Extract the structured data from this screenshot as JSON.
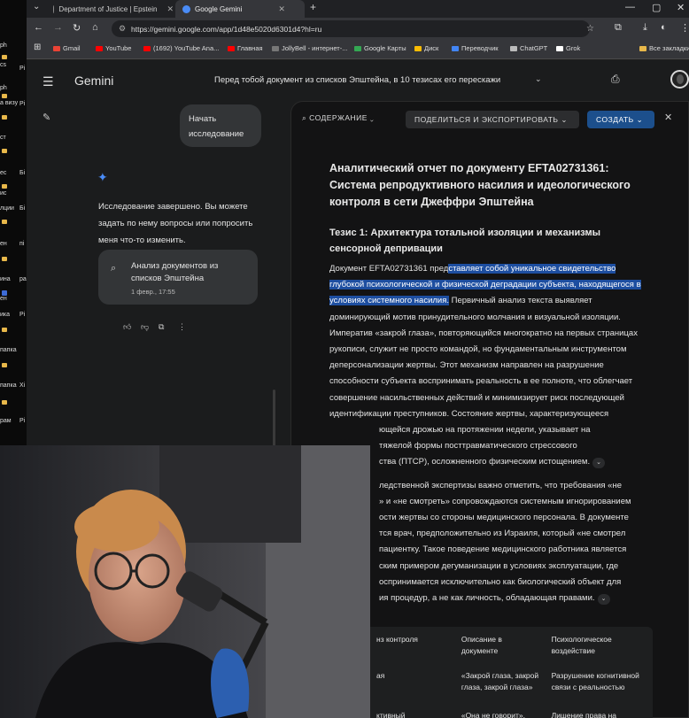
{
  "desktop": {
    "labels": [
      "ph",
      "cs",
      "ph",
      "a визу",
      "ст",
      "ес",
      "ис",
      "лции",
      "ен",
      "ина",
      "ен",
      "ика",
      "папка",
      "папка",
      "рам"
    ],
    "side_labels": [
      "Рi",
      "Рi",
      "Бi",
      "Бi",
      "пi",
      "ра",
      "Рi",
      "Хi",
      "Рi"
    ]
  },
  "browser": {
    "tabs": [
      {
        "title": "Department of Justice | Epstein",
        "active": false
      },
      {
        "title": "Google Gemini",
        "active": true
      }
    ],
    "new_tab": "+",
    "url": "https://gemini.google.com/app/1d48e5020d6301d4?hl=ru",
    "bookmarks": [
      {
        "label": "Gmail",
        "color": "#ea4335"
      },
      {
        "label": "YouTube",
        "color": "#ff0000"
      },
      {
        "label": "(1692) YouTube Ana...",
        "color": "#ff0000"
      },
      {
        "label": "Главная",
        "color": "#ff0000"
      },
      {
        "label": "JollyBell - интернет-...",
        "color": "#777777"
      },
      {
        "label": "Google Карты",
        "color": "#34a853"
      },
      {
        "label": "Диск",
        "color": "#fbbc04"
      },
      {
        "label": "Переводчик",
        "color": "#4285f4"
      },
      {
        "label": "ChatGPT",
        "color": "#bbbbbb"
      },
      {
        "label": "Grok",
        "color": "#ffffff"
      },
      {
        "label": "Все закладки",
        "color": "#e8b84a"
      }
    ]
  },
  "gemini": {
    "logo": "Gemini",
    "title": "Перед тобой документ из списков Эпштейна, в 10 тезисах его перескажи",
    "user_message": "Начать исследование",
    "reply": "Исследование завершено. Вы можете задать по нему вопросы или попросить меня что-то изменить.",
    "doc_card": {
      "title": "Анализ документов из списков Эпштейна",
      "date": "1 февр., 17:55"
    }
  },
  "panel": {
    "contents_label": "СОДЕРЖАНИЕ",
    "share_label": "ПОДЕЛИТЬСЯ И ЭКСПОРТИРОВАТЬ",
    "create_label": "СОЗДАТЬ",
    "doc_title": "Аналитический отчет по документу EFTA02731361: Система репродуктивного насилия и идеологического контроля в сети Джеффри Эпштейна",
    "section1_title": "Тезис 1: Архитектура тотальной изоляции и механизмы сенсорной депривации",
    "para1_pre": "Документ EFTA02731361 пред",
    "para1_hl": "ставляет собой уникальное свидетельство глубокой психологической и физической деградации субъекта, находящегося в условиях системного насилия.",
    "para1_post": " Первичный анализ текста выявляет доминирующий мотив принудительного молчания и визуальной изоляции. Императив «закрой глаза», повторяющийся многократно на первых страницах рукописи, служит не просто командой, но фундаментальным инструментом деперсонализации жертвы. Этот механизм направлен на разрушение способности субъекта воспринимать реальность в ее полноте, что облегчает совершение насильственных действий и минимизирует риск последующей идентификации преступников. Состояние жертвы, характеризующееся",
    "para1_tail": [
      "ющейся дрожью на протяжении недели, указывает на",
      "тяжелой формы посттравматического стрессового",
      "ства (ПТСР), осложненного физическим истощением."
    ],
    "para2_lines": [
      "ледственной экспертизы важно отметить, что требования «не",
      "» и «не смотреть» сопровождаются системным игнорированием",
      "ости жертвы со стороны медицинского персонала. В документе",
      "тся врач, предположительно из Израиля, который «не смотрел",
      "пациентку. Такое поведение медицинского работника является",
      "ским примером дегуманизации в условиях эксплуатации, где",
      "оспринимается исключительно как биологический объект для",
      "ия процедур, а не как личность, обладающая правами."
    ],
    "table": {
      "headers": [
        "нз контроля",
        "Описание в документе",
        "Психологическое воздействие"
      ],
      "rows": [
        [
          "ая",
          "«Закрой глаза, закрой глаза, закрой глаза»",
          "Разрушение когнитивной связи с реальностью"
        ],
        [
          "ктивный",
          "«Она не говорит», «Не говори»",
          "Лишение права на выражение боли и протеста"
        ]
      ]
    }
  }
}
